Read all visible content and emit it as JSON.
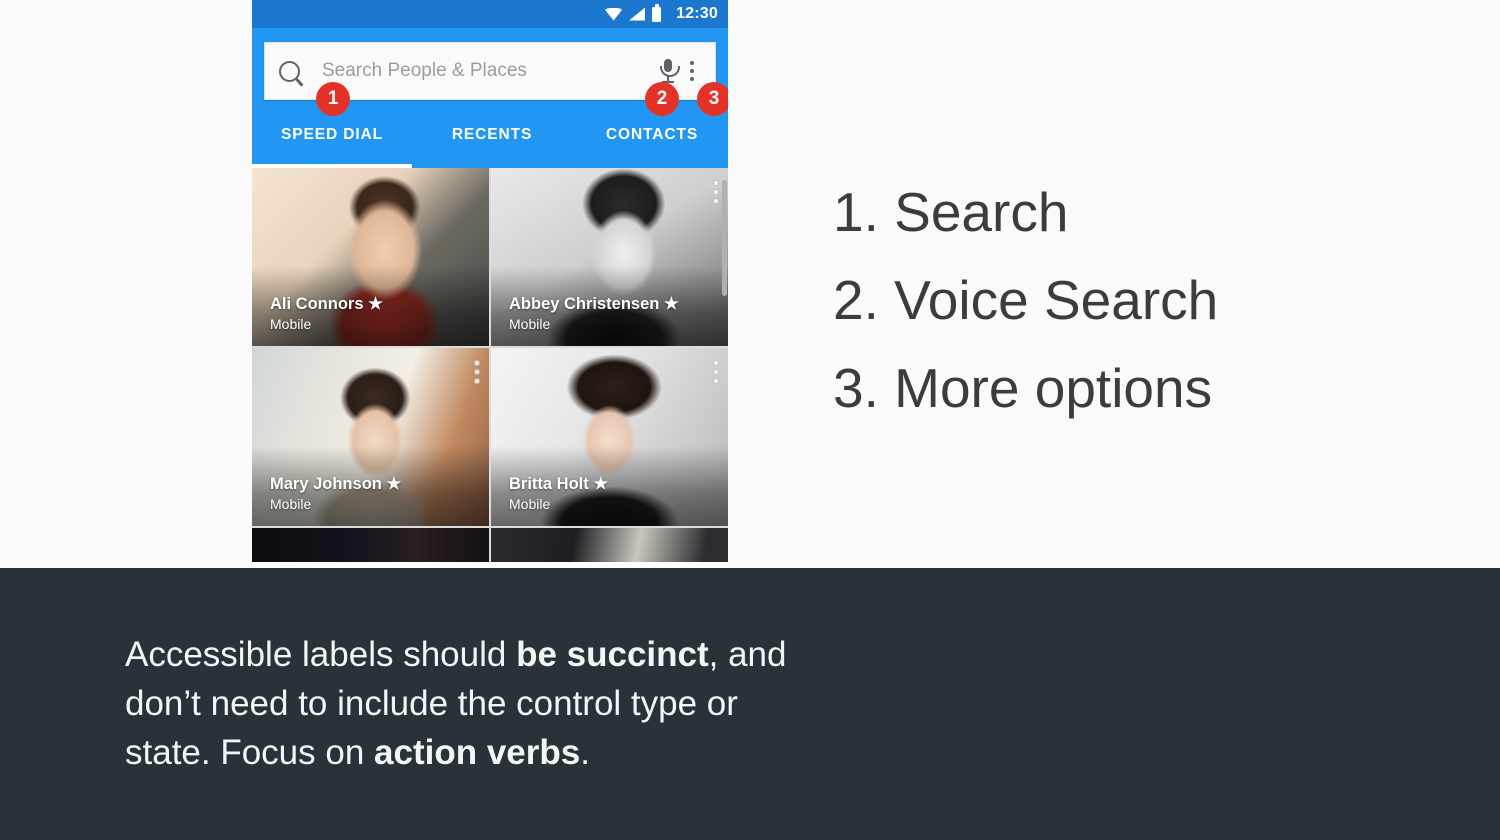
{
  "theme": {
    "status_bar_color": "#1b78ce",
    "app_bar_color": "#2196f3",
    "badge_color": "#e53228",
    "banner_color": "#293238",
    "page_background": "#fafafa"
  },
  "phone": {
    "status_bar": {
      "wifi_icon": "wifi-icon",
      "signal_icon": "signal-icon",
      "battery_icon": "battery-icon",
      "clock": "12:30"
    },
    "search": {
      "search_icon": "search-icon",
      "placeholder": "Search People  & Places",
      "value": "",
      "mic_icon": "microphone-icon",
      "overflow_icon": "more-options-icon"
    },
    "badges": {
      "search": "1",
      "voice": "2",
      "more": "3"
    },
    "tabs": [
      {
        "label": "SPEED DIAL",
        "active": true
      },
      {
        "label": "RECENTS",
        "active": false
      },
      {
        "label": "CONTACTS",
        "active": false
      }
    ],
    "contacts": [
      {
        "name": "Ali Connors",
        "star": "★",
        "label": "Mobile",
        "has_overflow": false
      },
      {
        "name": "Abbey Christensen",
        "star": "★",
        "label": "Mobile",
        "has_overflow": true
      },
      {
        "name": "Mary Johnson",
        "star": "★",
        "label": "Mobile",
        "has_overflow": true
      },
      {
        "name": "Britta Holt",
        "star": "★",
        "label": "Mobile",
        "has_overflow": true
      }
    ]
  },
  "legend": {
    "items": [
      "1. Search",
      "2. Voice Search",
      "3. More options"
    ]
  },
  "banner": {
    "line1_a": "Accessible labels should ",
    "line1_b": "be succinct",
    "line1_c": ", and",
    "line2": "don’t need to include the control type or",
    "line3_a": "state. Focus on ",
    "line3_b": "action verbs",
    "line3_c": "."
  }
}
